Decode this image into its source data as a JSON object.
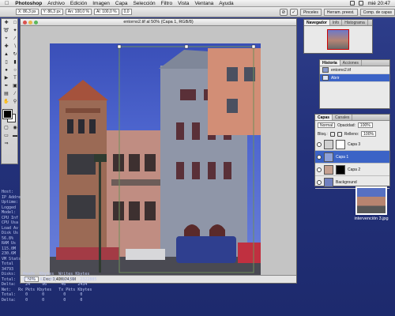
{
  "menubar": {
    "apple": "",
    "items": [
      "Photoshop",
      "Archivo",
      "Edición",
      "Imagen",
      "Capa",
      "Selección",
      "Filtro",
      "Vista",
      "Ventana",
      "Ayuda"
    ],
    "clock": "mié 20:47"
  },
  "options_bar": {
    "x_field": "X: 86,3 px",
    "y_field": "Y: 86,3 px",
    "w_field": "An: 100,0 %",
    "h_field": "Al: 100,0 %",
    "rot_field": "0,0",
    "tabs": [
      "Pinceles",
      "Herram. preest.",
      "Comp. de capas"
    ]
  },
  "document": {
    "title": "entorno2.tif al 50% (Capa 1, RGB/8)",
    "zoom": "50%",
    "doc_info": "Doc: 1,40M/24,9M"
  },
  "navigator_panel": {
    "tabs": [
      "Navegador",
      "Info",
      "Histograma"
    ]
  },
  "history_panel": {
    "tabs": [
      "Historia",
      "Acciones"
    ],
    "items": [
      {
        "label": "entorno2.tif",
        "selected": false
      },
      {
        "label": "Abrir",
        "selected": true
      }
    ]
  },
  "layers_panel": {
    "tabs": [
      "Capas",
      "Canales"
    ],
    "blend_mode": "Normal",
    "opacity_label": "Opacidad:",
    "opacity": "100%",
    "lock_label": "Bloq.:",
    "fill_label": "Relleno:",
    "fill": "100%",
    "layers": [
      {
        "name": "Capa 3",
        "selected": false
      },
      {
        "name": "Capa 1",
        "selected": true
      },
      {
        "name": "Capa 2",
        "selected": false
      },
      {
        "name": "Background",
        "selected": false
      }
    ]
  },
  "desktop_icon": {
    "caption": "intervención 3.jpg"
  },
  "system_monitor": {
    "lines": [
      "Host:",
      "IP Addre",
      "Uptime:",
      "Logged",
      "",
      "Model:",
      "",
      "CPU Inf",
      "CPU Usa",
      "Load Av",
      "",
      "Disk Us",
      "56.8%",
      "",
      "RAM Us",
      "115.0M",
      "230.6M",
      "",
      "VM Stats",
      "Total",
      "34793",
      "",
      "Disks:   Reads  Kbytes  Writes Kbytes",
      "Total:   95219  4215805  112286  2322885",
      "Delta:    24     96      46     2434",
      "",
      "Net:   Rx Pkts Kbytes   Tx Pkts Kbytes",
      "Total:    0      0        0      0",
      "Delta:    0      0        0      0"
    ]
  },
  "colors": {
    "desktop": "#23317a",
    "selection_blue": "#3b63c6",
    "foreground": "#000000",
    "background": "#ffffff"
  }
}
